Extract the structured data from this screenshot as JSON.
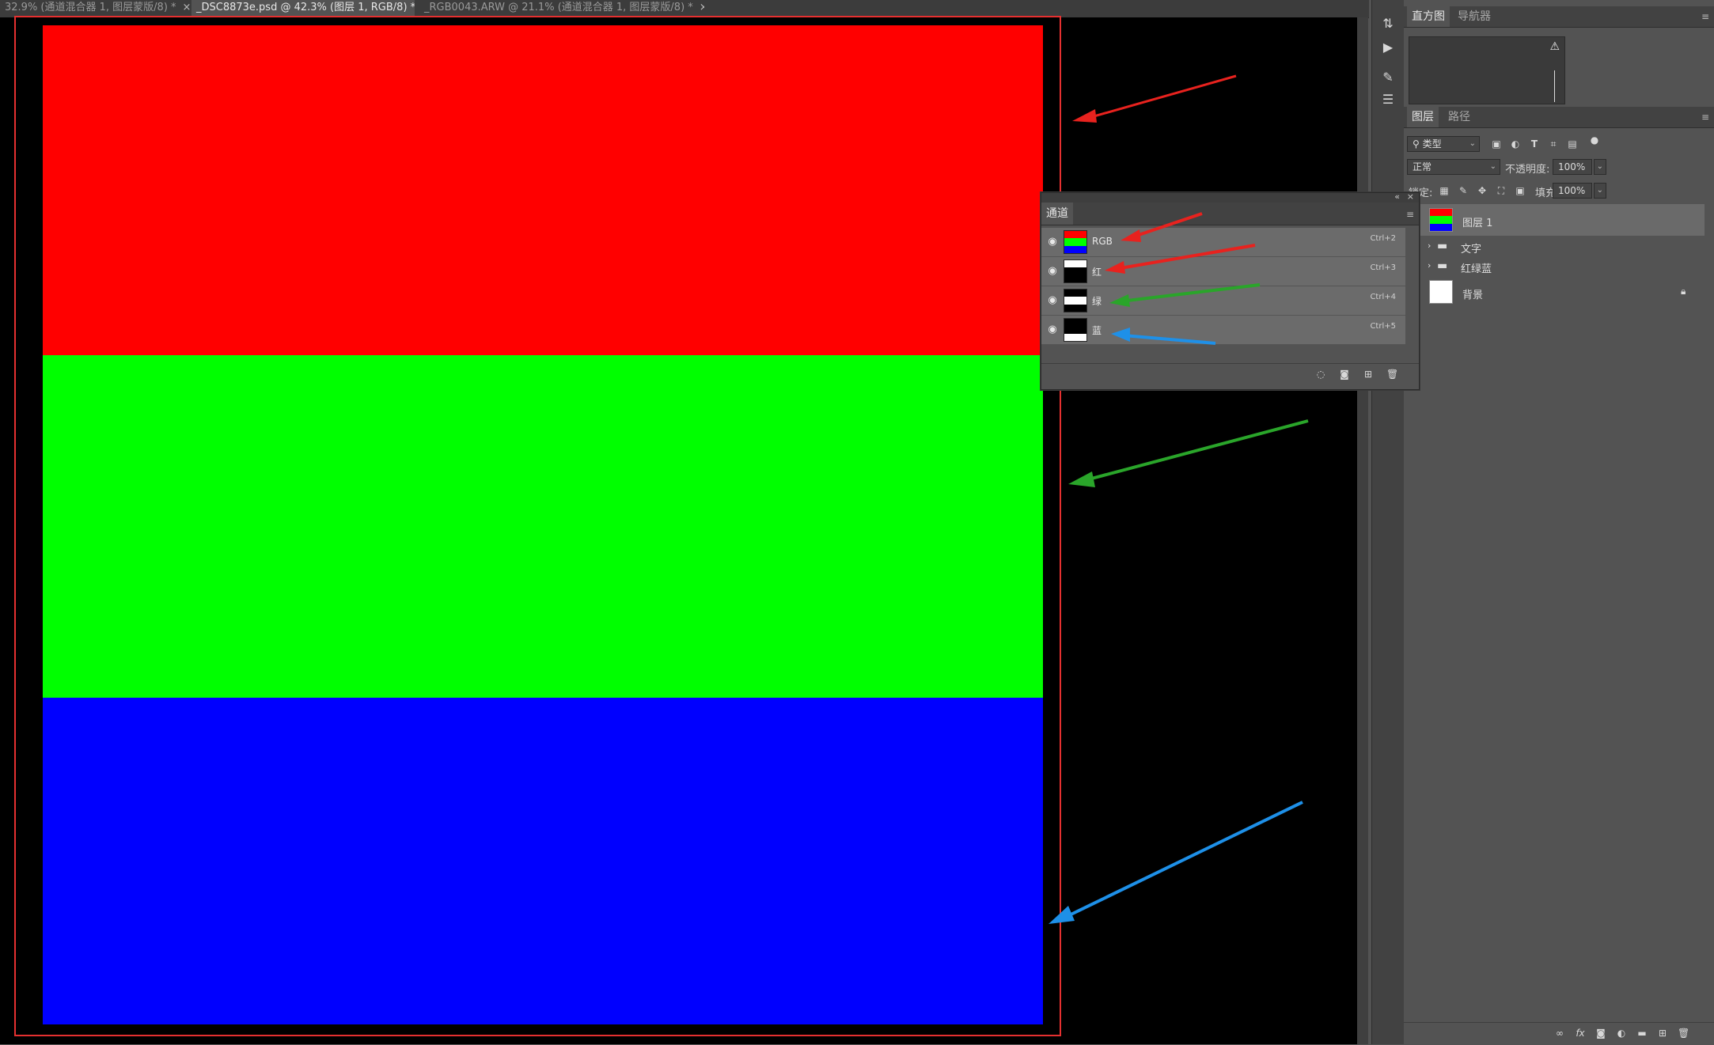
{
  "colors": {
    "red": "#ff0000",
    "green": "#00ff00",
    "blue": "#0000ff",
    "outline": "#e53030",
    "arrow_red": "#e8221e",
    "arrow_green": "#2aa52a",
    "arrow_blue": "#1e90e8"
  },
  "tabs": [
    {
      "label": "32.9% (通道混合器 1, 图层蒙版/8) *",
      "close": "×"
    },
    {
      "label": "_DSC8873e.psd @ 42.3% (图层 1, RGB/8) *",
      "close": "×"
    },
    {
      "label": "_RGB0043.ARW @ 21.1% (通道混合器 1, 图层蒙版/8) *",
      "close": "×"
    }
  ],
  "histogram_panel": {
    "tabs": [
      "直方图",
      "导航器"
    ],
    "warning": "⚠"
  },
  "layers_panel": {
    "tabs": [
      "图层",
      "路径"
    ],
    "filter_type": "类型",
    "blend_mode": "正常",
    "opacity_label": "不透明度:",
    "opacity_value": "100%",
    "lock_label": "锁定:",
    "fill_label": "填充:",
    "fill_value": "100%",
    "layers": [
      {
        "name": "图层 1"
      },
      {
        "name": "文字"
      },
      {
        "name": "红绿蓝"
      },
      {
        "name": "背景"
      }
    ],
    "footer_icons": [
      "link-icon",
      "fx-icon",
      "mask-icon",
      "adjustment-icon",
      "folder-icon",
      "new-layer-icon",
      "trash-icon"
    ],
    "fx": "fx"
  },
  "channels_panel": {
    "tab": "通道",
    "collapse": "«",
    "close": "×",
    "channels": [
      {
        "name": "RGB",
        "shortcut": "Ctrl+2"
      },
      {
        "name": "红",
        "shortcut": "Ctrl+3"
      },
      {
        "name": "绿",
        "shortcut": "Ctrl+4"
      },
      {
        "name": "蓝",
        "shortcut": "Ctrl+5"
      }
    ]
  }
}
